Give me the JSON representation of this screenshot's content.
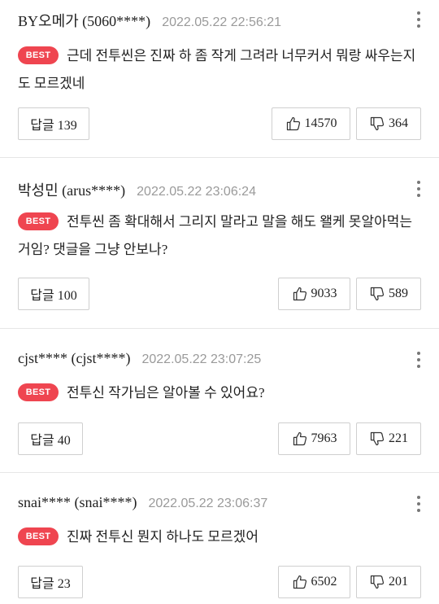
{
  "comments": [
    {
      "author": "BY오메가 (5060****)",
      "date": "2022.05.22 22:56:21",
      "badge": "BEST",
      "text": "근데 전투씬은 진짜 하 좀 작게 그려라 너무커서 뭐랑 싸우는지도 모르겠네",
      "reply_label": "답글 139",
      "likes": "14570",
      "dislikes": "364"
    },
    {
      "author": "박성민 (arus****)",
      "date": "2022.05.22 23:06:24",
      "badge": "BEST",
      "text": "전투씬 좀 확대해서 그리지 말라고 말을 해도 왤케 못알아먹는거임? 댓글을 그냥 안보나?",
      "reply_label": "답글 100",
      "likes": "9033",
      "dislikes": "589"
    },
    {
      "author": "cjst**** (cjst****)",
      "date": "2022.05.22 23:07:25",
      "badge": "BEST",
      "text": "전투신 작가님은 알아볼 수 있어요?",
      "reply_label": "답글 40",
      "likes": "7963",
      "dislikes": "221"
    },
    {
      "author": "snai**** (snai****)",
      "date": "2022.05.22 23:06:37",
      "badge": "BEST",
      "text": "진짜 전투신 뭔지 하나도 모르겠어",
      "reply_label": "답글 23",
      "likes": "6502",
      "dislikes": "201"
    }
  ],
  "icons": {
    "more": "more-vertical-icon",
    "like": "thumbs-up-icon",
    "dislike": "thumbs-down-icon"
  },
  "colors": {
    "badge": "#ef4550",
    "date": "#9a9a9a",
    "border": "#cfcfcf"
  }
}
